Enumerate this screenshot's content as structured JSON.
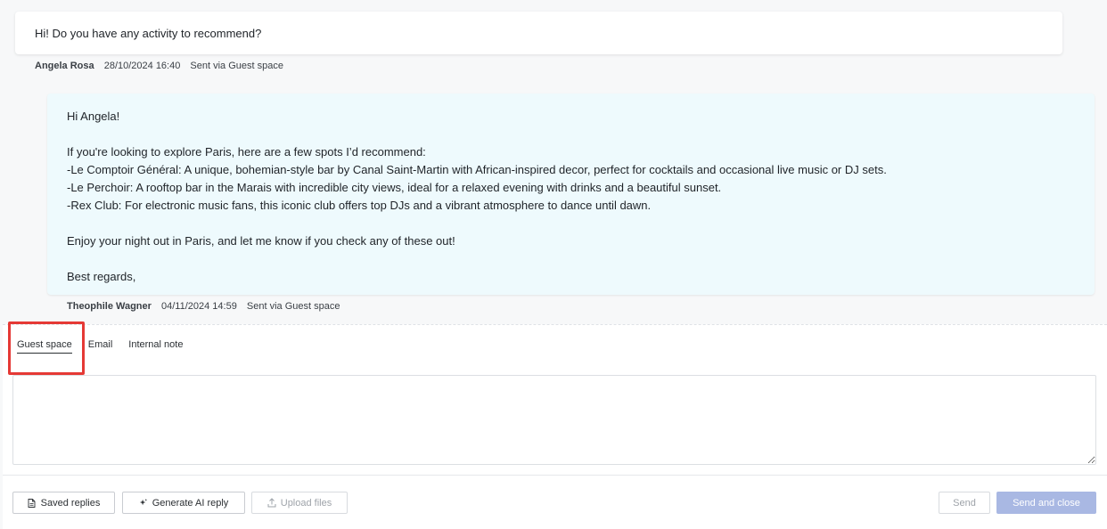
{
  "conversation": {
    "guest_message": {
      "text": "Hi! Do you have any activity to recommend?",
      "author": "Angela Rosa",
      "timestamp": "28/10/2024 16:40",
      "channel": "Sent via Guest space"
    },
    "host_message": {
      "lines": [
        "Hi Angela!",
        "",
        "If you're looking to explore Paris, here are a few spots I’d recommend:",
        "-Le Comptoir Général: A unique, bohemian-style bar by Canal Saint-Martin with African-inspired decor, perfect for cocktails and occasional live music or DJ sets.",
        "-Le Perchoir: A rooftop bar in the Marais with incredible city views, ideal for a relaxed evening with drinks and a beautiful sunset.",
        "-Rex Club: For electronic music fans, this iconic club offers top DJs and a vibrant atmosphere to dance until dawn.",
        "",
        "Enjoy your night out in Paris, and let me know if you check any of these out!",
        "",
        "Best regards,"
      ],
      "author": "Theophile Wagner",
      "timestamp": "04/11/2024 14:59",
      "channel": "Sent via Guest space"
    }
  },
  "composer": {
    "tabs": [
      {
        "label": "Guest space",
        "active": true
      },
      {
        "label": "Email",
        "active": false
      },
      {
        "label": "Internal note",
        "active": false
      }
    ],
    "reply_value": "",
    "buttons": {
      "saved_replies": "Saved replies",
      "generate_ai": "Generate AI reply",
      "upload_files": "Upload files",
      "send": "Send",
      "send_and_close": "Send and close"
    },
    "icons": {
      "saved_replies": "document-icon",
      "generate_ai": "sparkle-icon",
      "upload_files": "upload-icon"
    }
  },
  "colors": {
    "host_bubble": "#eefafd",
    "highlight": "#e53935",
    "primary_disabled": "#a9b8e3"
  }
}
